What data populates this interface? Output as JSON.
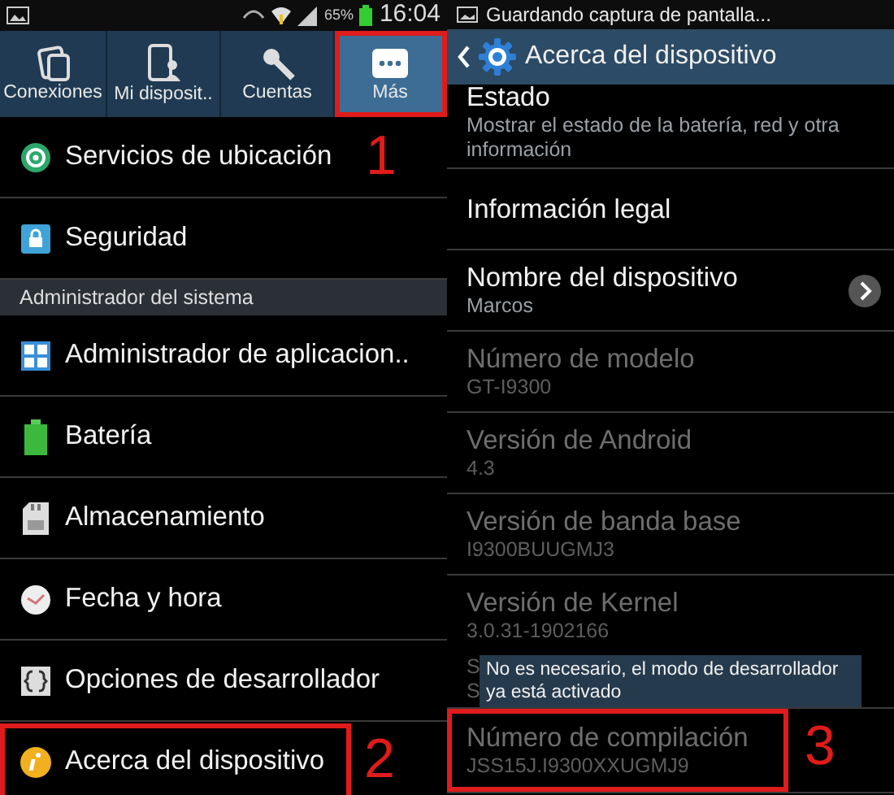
{
  "left_screen": {
    "status_bar": {
      "battery": "65%",
      "time": "16:04"
    },
    "tabs": [
      {
        "label": "Conexiones",
        "selected": false
      },
      {
        "label": "Mi disposit..",
        "selected": false
      },
      {
        "label": "Cuentas",
        "selected": false
      },
      {
        "label": "Más",
        "selected": true,
        "annotation": "1"
      }
    ],
    "list": [
      {
        "kind": "item",
        "label": "Servicios de ubicación"
      },
      {
        "kind": "item",
        "label": "Seguridad"
      },
      {
        "kind": "header",
        "label": "Administrador del sistema"
      },
      {
        "kind": "item",
        "label": "Administrador de aplicacion.."
      },
      {
        "kind": "item",
        "label": "Batería"
      },
      {
        "kind": "item",
        "label": "Almacenamiento"
      },
      {
        "kind": "item",
        "label": "Fecha y hora"
      },
      {
        "kind": "item",
        "label": "Opciones de desarrollador"
      },
      {
        "kind": "item",
        "label": "Acerca del dispositivo",
        "annotation": "2"
      }
    ]
  },
  "right_screen": {
    "status_bar": {
      "notification": "Guardando captura de pantalla..."
    },
    "title": "Acerca del dispositivo",
    "list": [
      {
        "title": "Estado",
        "values": [
          "Mostrar el estado de la batería, red y otra información"
        ],
        "disabled": false
      },
      {
        "title": "Información legal",
        "disabled": false
      },
      {
        "title": "Nombre del dispositivo",
        "values": [
          "Marcos"
        ],
        "disabled": false,
        "chevron": true
      },
      {
        "title": "Número de modelo",
        "values": [
          "GT-I9300"
        ],
        "disabled": true
      },
      {
        "title": "Versión de Android",
        "values": [
          "4.3"
        ],
        "disabled": true
      },
      {
        "title": "Versión de banda base",
        "values": [
          "I9300BUUGMJ3"
        ],
        "disabled": true
      },
      {
        "title": "Versión de Kernel",
        "values": [
          "3.0.31-1902166",
          "S",
          "S"
        ],
        "disabled": true,
        "toast": "No es necesario, el modo de desarrollador ya está activado"
      },
      {
        "title": "Número de compilación",
        "values": [
          "JSS15J.I9300XXUGMJ9"
        ],
        "disabled": true,
        "annotation": "3"
      }
    ]
  }
}
